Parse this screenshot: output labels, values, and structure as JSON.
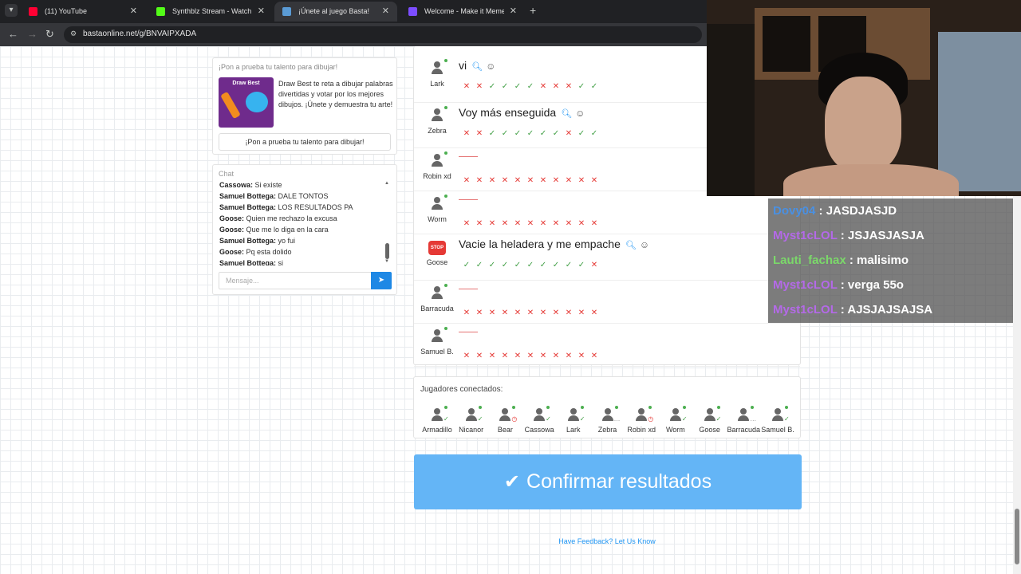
{
  "browser": {
    "tabs": [
      {
        "title": "(11) YouTube",
        "favicon_color": "#ff0033",
        "active": false
      },
      {
        "title": "Synthblz Stream - Watch Live o",
        "favicon_color": "#53fc18",
        "active": false
      },
      {
        "title": "¡Únete al juego Basta!",
        "favicon_color": "#5a9bd5",
        "active": true
      },
      {
        "title": "Welcome - Make it Meme",
        "favicon_color": "#7c4dff",
        "active": false
      }
    ],
    "url": "bastaonline.net/g/BNVAIPXADA"
  },
  "promo": {
    "header": "¡Pon a prueba tu talento para dibujar!",
    "logo_text": "Draw Best",
    "description": "Draw Best te reta a dibujar palabras divertidas y votar por los mejores dibujos. ¡Únete y demuestra tu arte!",
    "button_label": "¡Pon a prueba tu talento para dibujar!"
  },
  "chat": {
    "header": "Chat",
    "messages": [
      {
        "user": "Cassowa:",
        "text": " Si existe"
      },
      {
        "user": "Samuel Bottega:",
        "text": " DALE TONTOS"
      },
      {
        "user": "Samuel Bottega:",
        "text": " LOS RESULTADOS PA"
      },
      {
        "user": "Goose:",
        "text": " Quien me rechazo la excusa"
      },
      {
        "user": "Goose:",
        "text": " Que me lo diga en la cara"
      },
      {
        "user": "Samuel Bottega:",
        "text": " yo fui"
      },
      {
        "user": "Goose:",
        "text": " Pq esta dolido"
      },
      {
        "user": "Samuel Bottega:",
        "text": " si"
      }
    ],
    "input_placeholder": "Mensaje..."
  },
  "answers": [
    {
      "player": "Lark",
      "answer": "vi",
      "marks": [
        "x",
        "x",
        "ok",
        "ok",
        "ok",
        "ok",
        "x",
        "x",
        "x",
        "ok",
        "ok"
      ]
    },
    {
      "player": "Zebra",
      "answer": "Voy más enseguida",
      "marks": [
        "x",
        "x",
        "ok",
        "ok",
        "ok",
        "ok",
        "ok",
        "ok",
        "x",
        "ok",
        "ok"
      ]
    },
    {
      "player": "Robin xd",
      "answer": "",
      "marks": [
        "x",
        "x",
        "x",
        "x",
        "x",
        "x",
        "x",
        "x",
        "x",
        "x",
        "x"
      ]
    },
    {
      "player": "Worm",
      "answer": "",
      "marks": [
        "x",
        "x",
        "x",
        "x",
        "x",
        "x",
        "x",
        "x",
        "x",
        "x",
        "x"
      ]
    },
    {
      "player": "Goose",
      "answer": "Vacie la heladera y me empache",
      "badge": "stop",
      "marks": [
        "ok",
        "ok",
        "ok",
        "ok",
        "ok",
        "ok",
        "ok",
        "ok",
        "ok",
        "ok",
        "x"
      ]
    },
    {
      "player": "Barracuda",
      "answer": "",
      "marks": [
        "x",
        "x",
        "x",
        "x",
        "x",
        "x",
        "x",
        "x",
        "x",
        "x",
        "x"
      ]
    },
    {
      "player": "Samuel B.",
      "answer": "",
      "marks": [
        "x",
        "x",
        "x",
        "x",
        "x",
        "x",
        "x",
        "x",
        "x",
        "x",
        "x"
      ]
    }
  ],
  "players": {
    "header": "Jugadores conectados:",
    "list": [
      {
        "name": "Armadillo",
        "status": "ok"
      },
      {
        "name": "Nicanor",
        "status": "ok"
      },
      {
        "name": "Bear",
        "status": "wait"
      },
      {
        "name": "Cassowa",
        "status": "ok"
      },
      {
        "name": "Lark",
        "status": "ok"
      },
      {
        "name": "Zebra",
        "status": "dots"
      },
      {
        "name": "Robin xd",
        "status": "wait"
      },
      {
        "name": "Worm",
        "status": "ok"
      },
      {
        "name": "Goose",
        "status": "ok"
      },
      {
        "name": "Barracuda",
        "status": "dots"
      },
      {
        "name": "Samuel B.",
        "status": "ok"
      }
    ]
  },
  "confirm_label": "Confirmar resultados",
  "feedback_link": "Have Feedback? Let Us Know",
  "stream_chat": [
    {
      "user": "Dovy04",
      "color": "#4a90e2",
      "text": " : JASDJASJD"
    },
    {
      "user": "Myst1cLOL",
      "color": "#b469e8",
      "text": " : JSJASJASJA"
    },
    {
      "user": "Lauti_fachax",
      "color": "#7bd86a",
      "text": " : malisimo"
    },
    {
      "user": "Myst1cLOL",
      "color": "#b469e8",
      "text": " : verga 55o"
    },
    {
      "user": "Myst1cLOL",
      "color": "#b469e8",
      "text": " : AJSJAJSAJSA"
    }
  ]
}
